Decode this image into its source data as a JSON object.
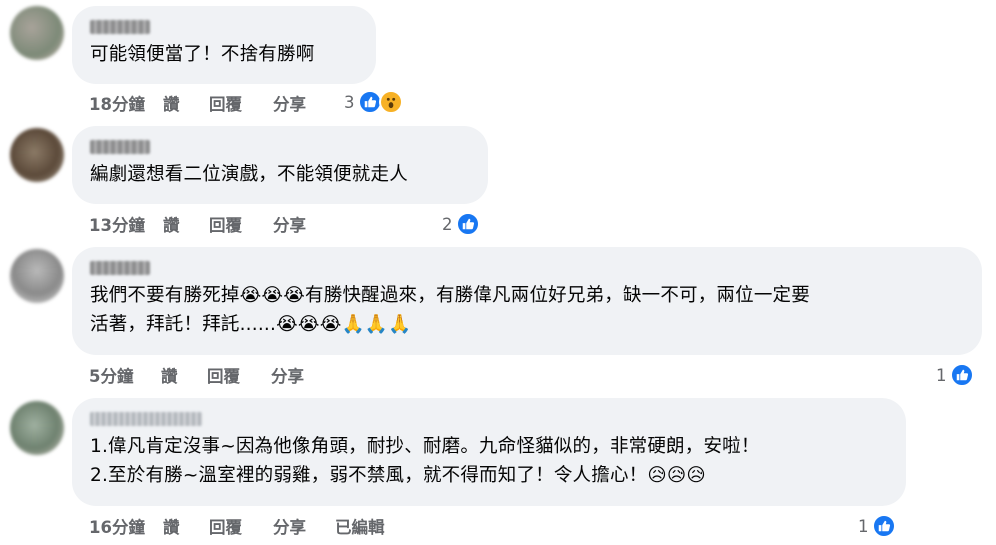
{
  "comments": [
    {
      "text": "可能領便當了！不捨有勝啊",
      "time": "18分鐘",
      "like": "讚",
      "reply": "回覆",
      "share": "分享",
      "edited": "",
      "reaction_count": "3",
      "reactions": [
        "like-icon",
        "wow-icon"
      ]
    },
    {
      "text": "編劇還想看二位演戲，不能領便就走人",
      "time": "13分鐘",
      "like": "讚",
      "reply": "回覆",
      "share": "分享",
      "edited": "",
      "reaction_count": "2",
      "reactions": [
        "like-icon"
      ]
    },
    {
      "text": "我們不要有勝死掉😭😭😭有勝快醒過來，有勝偉凡兩位好兄弟，缺一不可，兩位一定要\n活著，拜託！拜託......😭😭😭🙏🙏🙏",
      "time": "5分鐘",
      "like": "讚",
      "reply": "回覆",
      "share": "分享",
      "edited": "",
      "reaction_count": "1",
      "reactions": [
        "like-icon"
      ]
    },
    {
      "text": "1.偉凡肯定沒事~因為他像角頭，耐抄、耐磨。九命怪貓似的，非常硬朗，安啦！\n2.至於有勝~溫室裡的弱雞，弱不禁風，就不得而知了！令人擔心！😥😥😥",
      "time": "16分鐘",
      "like": "讚",
      "reply": "回覆",
      "share": "分享",
      "edited": "已編輯",
      "reaction_count": "1",
      "reactions": [
        "like-icon"
      ]
    }
  ],
  "colors": {
    "bubble": "#f0f2f5",
    "meta": "#65676b",
    "like": "#1877f2",
    "wow": "#f7b125"
  }
}
